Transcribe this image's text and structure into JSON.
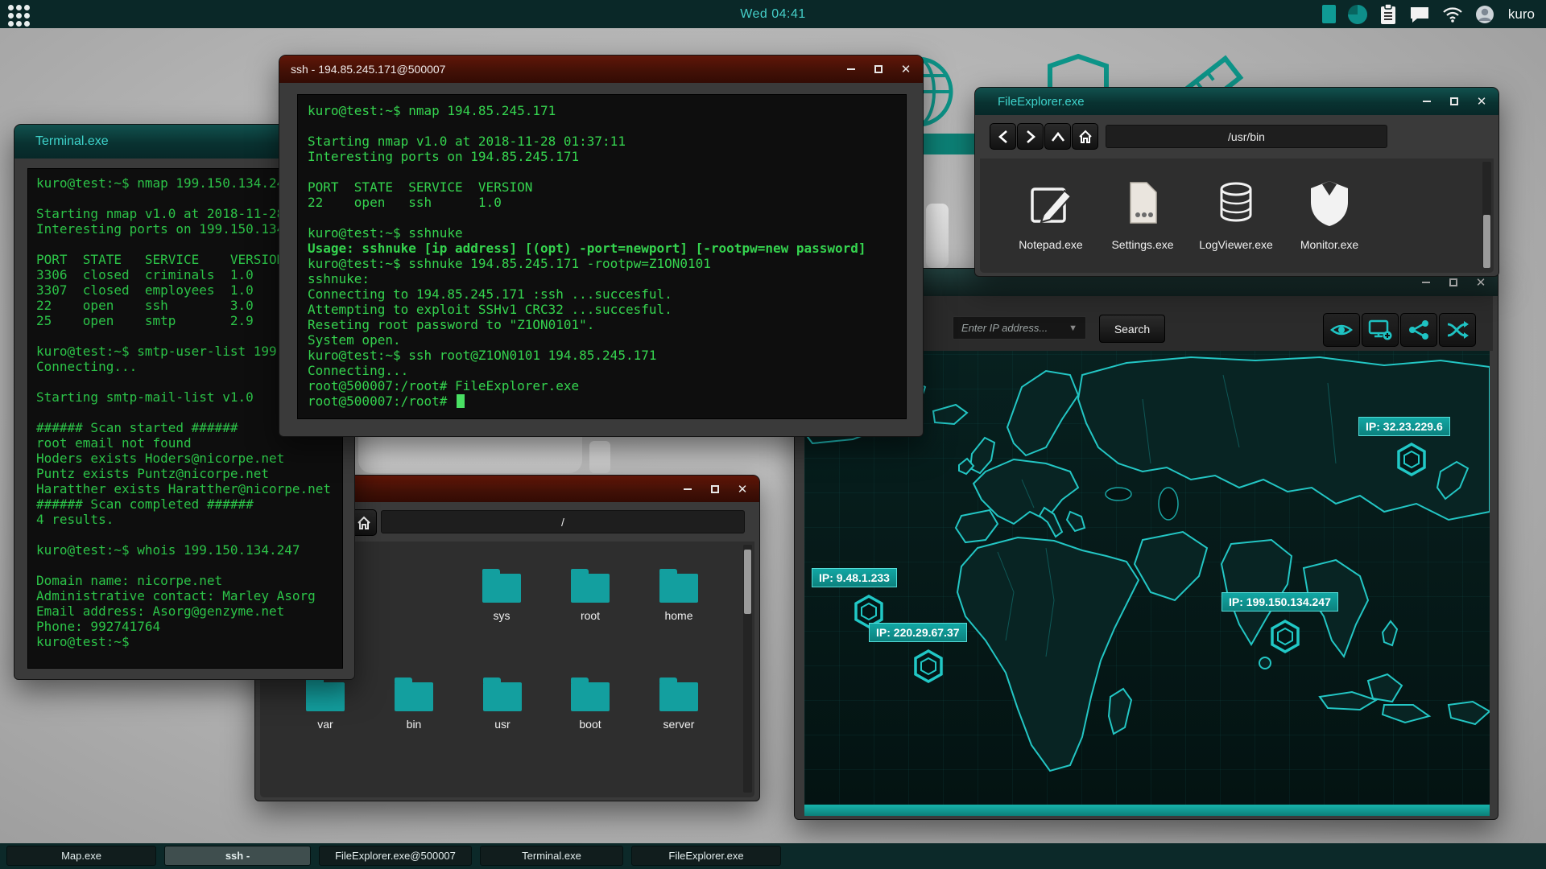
{
  "topbar": {
    "clock": "Wed 04:41",
    "username": "kuro"
  },
  "taskbar": {
    "items": [
      {
        "label": "Map.exe",
        "active": false
      },
      {
        "label": "ssh -",
        "active": true
      },
      {
        "label": "FileExplorer.exe@500007",
        "active": false
      },
      {
        "label": "Terminal.exe",
        "active": false
      },
      {
        "label": "FileExplorer.exe",
        "active": false
      }
    ]
  },
  "terminal_window": {
    "title": "Terminal.exe",
    "content": "kuro@test:~$ nmap 199.150.134.247\n\nStarting nmap v1.0 at 2018-11-28 01:37:11\nInteresting ports on 199.150.134.247\n\nPORT  STATE   SERVICE    VERSION\n3306  closed  criminals  1.0\n3307  closed  employees  1.0\n22    open    ssh        3.0\n25    open    smtp       2.9\n\nkuro@test:~$ smtp-user-list 199.150.134.247\nConnecting...\n\nStarting smtp-mail-list v1.0\n\n###### Scan started ######\nroot email not found\nHoders exists Hoders@nicorpe.net\nPuntz exists Puntz@nicorpe.net\nHaratther exists Haratther@nicorpe.net\n###### Scan completed ######\n4 results.\n\nkuro@test:~$ whois 199.150.134.247\n\nDomain name: nicorpe.net\nAdministrative contact: Marley Asorg\nEmail address: Asorg@genzyme.net\nPhone: 992741764\nkuro@test:~$"
  },
  "ssh_window": {
    "title": "ssh - 194.85.245.171@500007",
    "content_top": "kuro@test:~$ nmap 194.85.245.171\n\nStarting nmap v1.0 at 2018-11-28 01:37:11\nInteresting ports on 194.85.245.171\n\nPORT  STATE  SERVICE  VERSION\n22    open   ssh      1.0\n\nkuro@test:~$ sshnuke",
    "usage_line": "Usage: sshnuke [ip address] [(opt) -port=newport] [-rootpw=new password]",
    "content_bottom": "kuro@test:~$ sshnuke 194.85.245.171 -rootpw=Z1ON0101\nsshnuke:\nConnecting to 194.85.245.171 :ssh ...succesful.\nAttempting to exploit SSHv1 CRC32 ...succesful.\nReseting root password to \"Z1ON0101\".\nSystem open.\nkuro@test:~$ ssh root@Z1ON0101 194.85.245.171\nConnecting...\nroot@500007:/root# FileExplorer.exe",
    "prompt_line": "root@500007:/root# "
  },
  "file_explorer_top": {
    "title": "FileExplorer.exe",
    "address": "/usr/bin",
    "items": [
      {
        "label": "Notepad.exe"
      },
      {
        "label": "Settings.exe"
      },
      {
        "label": "LogViewer.exe"
      },
      {
        "label": "Monitor.exe"
      }
    ]
  },
  "file_explorer_remote": {
    "title": "",
    "address": "/",
    "folders_row1": [
      "sys",
      "root",
      "home"
    ],
    "folders_row2": [
      "var",
      "bin",
      "usr",
      "boot",
      "server"
    ]
  },
  "map_window": {
    "title": "Map.exe",
    "search_placeholder": "Enter IP address...",
    "search_button": "Search",
    "markers": [
      {
        "label": "IP: 32.23.229.6"
      },
      {
        "label": "IP: 9.48.1.233"
      },
      {
        "label": "IP: 220.29.67.37"
      },
      {
        "label": "IP: 199.150.134.247"
      }
    ]
  },
  "colors": {
    "accent_teal": "#14a5a0",
    "terminal_green": "#2cc348",
    "titlebar_maroon": "#4c1206",
    "desktop_gray": "#b2b2b2"
  }
}
